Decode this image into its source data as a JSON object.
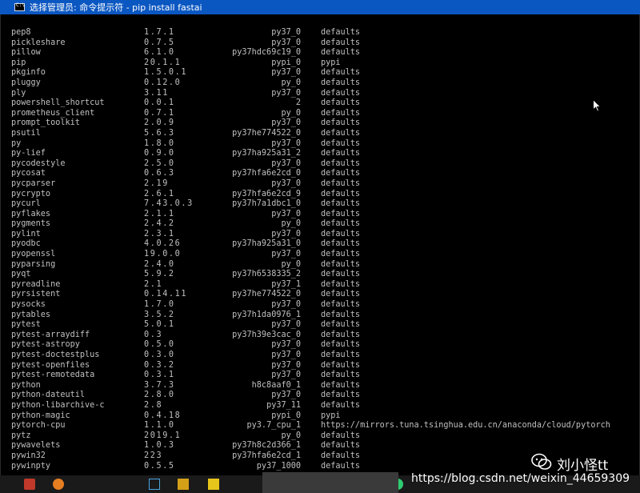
{
  "window": {
    "title": "选择管理员: 命令提示符 - pip  install fastai"
  },
  "packages": [
    {
      "name": "pep8",
      "version": "1.7.1",
      "build": "py37_0",
      "channel": "defaults"
    },
    {
      "name": "pickleshare",
      "version": "0.7.5",
      "build": "py37_0",
      "channel": "defaults"
    },
    {
      "name": "pillow",
      "version": "6.1.0",
      "build": "py37hdc69c19_0",
      "channel": "defaults"
    },
    {
      "name": "pip",
      "version": "20.1.1",
      "build": "pypi_0",
      "channel": "pypi"
    },
    {
      "name": "pkginfo",
      "version": "1.5.0.1",
      "build": "py37_0",
      "channel": "defaults"
    },
    {
      "name": "pluggy",
      "version": "0.12.0",
      "build": "py_0",
      "channel": "defaults"
    },
    {
      "name": "ply",
      "version": "3.11",
      "build": "py37_0",
      "channel": "defaults"
    },
    {
      "name": "powershell_shortcut",
      "version": "0.0.1",
      "build": "2",
      "channel": "defaults"
    },
    {
      "name": "prometheus_client",
      "version": "0.7.1",
      "build": "py_0",
      "channel": "defaults"
    },
    {
      "name": "prompt_toolkit",
      "version": "2.0.9",
      "build": "py37_0",
      "channel": "defaults"
    },
    {
      "name": "psutil",
      "version": "5.6.3",
      "build": "py37he774522_0",
      "channel": "defaults"
    },
    {
      "name": "py",
      "version": "1.8.0",
      "build": "py37_0",
      "channel": "defaults"
    },
    {
      "name": "py-lief",
      "version": "0.9.0",
      "build": "py37ha925a31_2",
      "channel": "defaults"
    },
    {
      "name": "pycodestyle",
      "version": "2.5.0",
      "build": "py37_0",
      "channel": "defaults"
    },
    {
      "name": "pycosat",
      "version": "0.6.3",
      "build": "py37hfa6e2cd_0",
      "channel": "defaults"
    },
    {
      "name": "pycparser",
      "version": "2.19",
      "build": "py37_0",
      "channel": "defaults"
    },
    {
      "name": "pycrypto",
      "version": "2.6.1",
      "build": "py37hfa6e2cd_9",
      "channel": "defaults"
    },
    {
      "name": "pycurl",
      "version": "7.43.0.3",
      "build": "py37h7a1dbc1_0",
      "channel": "defaults"
    },
    {
      "name": "pyflakes",
      "version": "2.1.1",
      "build": "py37_0",
      "channel": "defaults"
    },
    {
      "name": "pygments",
      "version": "2.4.2",
      "build": "py_0",
      "channel": "defaults"
    },
    {
      "name": "pylint",
      "version": "2.3.1",
      "build": "py37_0",
      "channel": "defaults"
    },
    {
      "name": "pyodbc",
      "version": "4.0.26",
      "build": "py37ha925a31_0",
      "channel": "defaults"
    },
    {
      "name": "pyopenssl",
      "version": "19.0.0",
      "build": "py37_0",
      "channel": "defaults"
    },
    {
      "name": "pyparsing",
      "version": "2.4.0",
      "build": "py_0",
      "channel": "defaults"
    },
    {
      "name": "pyqt",
      "version": "5.9.2",
      "build": "py37h6538335_2",
      "channel": "defaults"
    },
    {
      "name": "pyreadline",
      "version": "2.1",
      "build": "py37_1",
      "channel": "defaults"
    },
    {
      "name": "pyrsistent",
      "version": "0.14.11",
      "build": "py37he774522_0",
      "channel": "defaults"
    },
    {
      "name": "pysocks",
      "version": "1.7.0",
      "build": "py37_0",
      "channel": "defaults"
    },
    {
      "name": "pytables",
      "version": "3.5.2",
      "build": "py37h1da0976_1",
      "channel": "defaults"
    },
    {
      "name": "pytest",
      "version": "5.0.1",
      "build": "py37_0",
      "channel": "defaults"
    },
    {
      "name": "pytest-arraydiff",
      "version": "0.3",
      "build": "py37h39e3cac_0",
      "channel": "defaults"
    },
    {
      "name": "pytest-astropy",
      "version": "0.5.0",
      "build": "py37_0",
      "channel": "defaults"
    },
    {
      "name": "pytest-doctestplus",
      "version": "0.3.0",
      "build": "py37_0",
      "channel": "defaults"
    },
    {
      "name": "pytest-openfiles",
      "version": "0.3.2",
      "build": "py37_0",
      "channel": "defaults"
    },
    {
      "name": "pytest-remotedata",
      "version": "0.3.1",
      "build": "py37_0",
      "channel": "defaults"
    },
    {
      "name": "python",
      "version": "3.7.3",
      "build": "h8c8aaf0_1",
      "channel": "defaults"
    },
    {
      "name": "python-dateutil",
      "version": "2.8.0",
      "build": "py37_0",
      "channel": "defaults"
    },
    {
      "name": "python-libarchive-c",
      "version": "2.8",
      "build": "py37_11",
      "channel": "defaults"
    },
    {
      "name": "python-magic",
      "version": "0.4.18",
      "build": "pypi_0",
      "channel": "pypi"
    },
    {
      "name": "pytorch-cpu",
      "version": "1.1.0",
      "build": "py3.7_cpu_1",
      "channel": "https://mirrors.tuna.tsinghua.edu.cn/anaconda/cloud/pytorch"
    },
    {
      "name": "pytz",
      "version": "2019.1",
      "build": "py_0",
      "channel": "defaults"
    },
    {
      "name": "pywavelets",
      "version": "1.0.3",
      "build": "py37h8c2d366_1",
      "channel": "defaults"
    },
    {
      "name": "pywin32",
      "version": "223",
      "build": "py37hfa6e2cd_1",
      "channel": "defaults"
    },
    {
      "name": "pywinpty",
      "version": "0.5.5",
      "build": "py37_1000",
      "channel": "defaults"
    }
  ],
  "watermark": {
    "url": "https://blog.csdn.net/weixin_44659309",
    "author": "刘小怪tt"
  },
  "colors": {
    "titlebar": "#0b57c2",
    "console_bg": "#000000",
    "console_text": "#c0c0c0"
  }
}
